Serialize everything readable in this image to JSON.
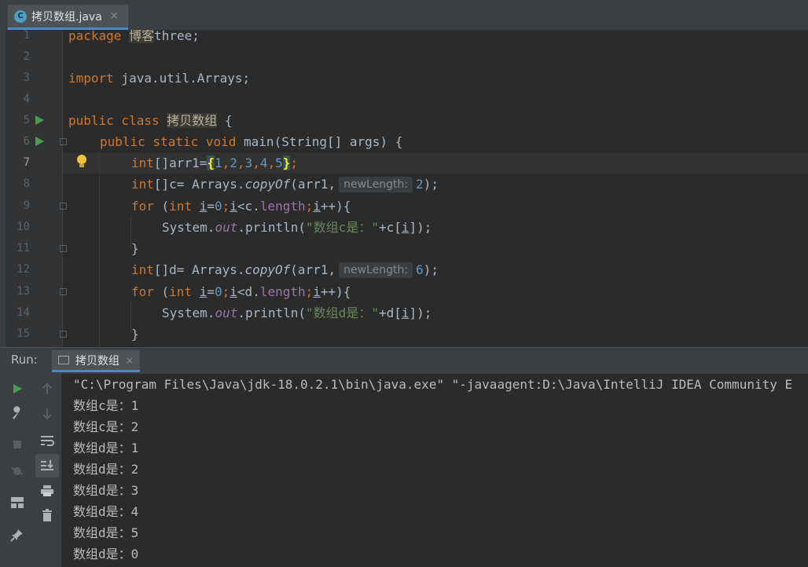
{
  "editor_tab": {
    "label": "拷贝数组.java",
    "close": "×"
  },
  "code_lines": [
    {
      "n": "1"
    },
    {
      "n": "2"
    },
    {
      "n": "3"
    },
    {
      "n": "4"
    },
    {
      "n": "5"
    },
    {
      "n": "6"
    },
    {
      "n": "7"
    },
    {
      "n": "8"
    },
    {
      "n": "9"
    },
    {
      "n": "10"
    },
    {
      "n": "11"
    },
    {
      "n": "12"
    },
    {
      "n": "13"
    },
    {
      "n": "14"
    },
    {
      "n": "15"
    }
  ],
  "code": {
    "l1_kw": "package",
    "l1_pkg": "博客",
    "l1_rest": "three;",
    "l3_kw": "import",
    "l3_rest": " java.util.Arrays;",
    "l5_kw": "public class ",
    "l5_cls": "拷贝数组",
    "l5_rest": " {",
    "l6_kw": "public static void ",
    "l6_rest": "main(String[] args) {",
    "l7_kw": "int",
    "l7_a": "[]arr1=",
    "l7_ob": "{",
    "n1": "1",
    "n2": "2",
    "n3": "3",
    "n4": "4",
    "n5": "5",
    "l7_cb": "}",
    "l7_end": ";",
    "comma": ",",
    "l8_kw": "int",
    "l8_a": "[]c= Arrays.",
    "l8_m": "copyOf",
    "l8_b": "(arr1,",
    "hint": "newLength:",
    "l8_n": "2",
    "l8_end": ");",
    "l9_kw": "for",
    "l9_a": " (",
    "l9_int": "int",
    "l9_i": "i",
    "l9_eq": "=",
    "l9_z": "0",
    "l9_semi": ";",
    "l9_lt": "<c.",
    "l9_len": "length",
    "l9_inc": "++){",
    "l10_a": "System.",
    "l10_out": "out",
    "l10_b": ".println(",
    "l10_str": "\"数组c是：\"",
    "l10_c": "+c[",
    "l10_d": "]);",
    "l11": "}",
    "l12_kw": "int",
    "l12_a": "[]d= Arrays.",
    "l12_n": "6",
    "l13_lt": "<d.",
    "l14_str": "\"数组d是：\"",
    "l14_c": "+d[",
    "l15": "}"
  },
  "run_panel": {
    "label": "Run:",
    "tab": "拷贝数组",
    "tab_close": "×",
    "output": [
      "\"C:\\Program Files\\Java\\jdk-18.0.2.1\\bin\\java.exe\" \"-javaagent:D:\\Java\\IntelliJ IDEA Community E",
      "数组c是：1",
      "数组c是：2",
      "数组d是：1",
      "数组d是：2",
      "数组d是：3",
      "数组d是：4",
      "数组d是：5",
      "数组d是：0"
    ]
  },
  "colors": {
    "keyword": "#cc7832",
    "number": "#6897bb",
    "string": "#6a8759",
    "field": "#9876aa",
    "run_green": "#499c54"
  },
  "icons": [
    "java-class-icon",
    "run-icon",
    "fold-icon",
    "bulb-icon",
    "wrench-icon",
    "stop-icon",
    "debug-icon",
    "layout-icon",
    "pin-icon",
    "up-arrow-icon",
    "down-arrow-icon",
    "soft-wrap-icon",
    "scroll-to-end-icon",
    "print-icon",
    "trash-icon",
    "console-tab-icon"
  ]
}
